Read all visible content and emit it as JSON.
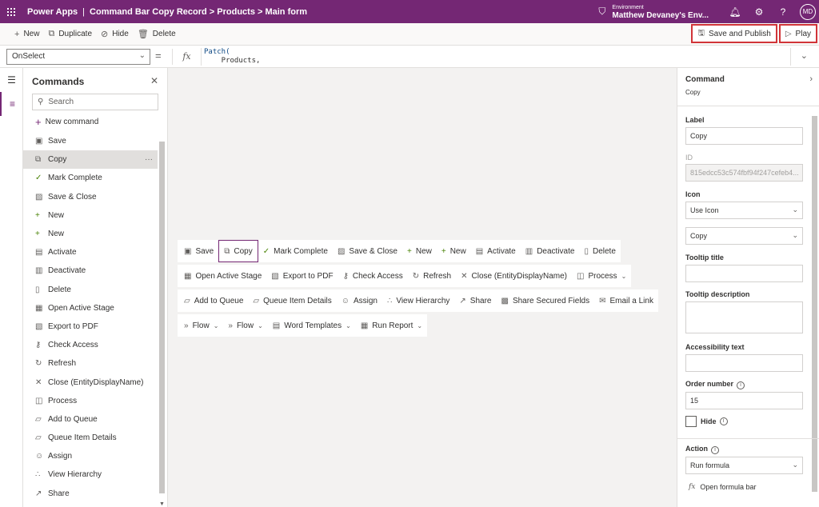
{
  "header": {
    "app_name": "Power Apps",
    "breadcrumb": "Command Bar Copy Record > Products > Main form",
    "environment_label": "Environment",
    "environment_name": "Matthew Devaney's Env...",
    "avatar_initials": "MD"
  },
  "toolbar": {
    "new_label": "New",
    "duplicate_label": "Duplicate",
    "hide_label": "Hide",
    "delete_label": "Delete",
    "save_publish_label": "Save and Publish",
    "play_label": "Play"
  },
  "formula": {
    "property": "OnSelect",
    "line1": "Patch(",
    "line2": "    Products,"
  },
  "commands_panel": {
    "title": "Commands",
    "search_placeholder": "Search",
    "new_command_label": "New command",
    "items": [
      {
        "label": "Save",
        "icon": "save-icon"
      },
      {
        "label": "Copy",
        "icon": "copy-icon"
      },
      {
        "label": "Mark Complete",
        "icon": "checkmark-icon"
      },
      {
        "label": "Save & Close",
        "icon": "save-close-icon"
      },
      {
        "label": "New",
        "icon": "add-icon"
      },
      {
        "label": "New",
        "icon": "add-icon"
      },
      {
        "label": "Activate",
        "icon": "activate-icon"
      },
      {
        "label": "Deactivate",
        "icon": "deactivate-icon"
      },
      {
        "label": "Delete",
        "icon": "delete-icon"
      },
      {
        "label": "Open Active Stage",
        "icon": "stage-icon"
      },
      {
        "label": "Export to PDF",
        "icon": "pdf-icon"
      },
      {
        "label": "Check Access",
        "icon": "key-icon"
      },
      {
        "label": "Refresh",
        "icon": "refresh-icon"
      },
      {
        "label": "Close (EntityDisplayName)",
        "icon": "close-icon"
      },
      {
        "label": "Process",
        "icon": "process-icon"
      },
      {
        "label": "Add to Queue",
        "icon": "queue-icon"
      },
      {
        "label": "Queue Item Details",
        "icon": "queue-details-icon"
      },
      {
        "label": "Assign",
        "icon": "assign-icon"
      },
      {
        "label": "View Hierarchy",
        "icon": "hierarchy-icon"
      },
      {
        "label": "Share",
        "icon": "share-icon"
      }
    ]
  },
  "canvas": {
    "rows": [
      [
        "Save",
        "Copy",
        "Mark Complete",
        "Save & Close",
        "New",
        "New",
        "Activate",
        "Deactivate",
        "Delete"
      ],
      [
        "Open Active Stage",
        "Export to PDF",
        "Check Access",
        "Refresh",
        "Close (EntityDisplayName)",
        "Process"
      ],
      [
        "Add to Queue",
        "Queue Item Details",
        "Assign",
        "View Hierarchy",
        "Share",
        "Share Secured Fields",
        "Email a Link"
      ],
      [
        "Flow",
        "Flow",
        "Word Templates",
        "Run Report"
      ]
    ]
  },
  "properties": {
    "title": "Command",
    "subtitle": "Copy",
    "label_label": "Label",
    "label_value": "Copy",
    "id_label": "ID",
    "id_value": "815edcc53c574fbf94f247cefeb4...",
    "icon_label": "Icon",
    "icon_mode": "Use Icon",
    "icon_value": "Copy",
    "tooltip_title_label": "Tooltip title",
    "tooltip_desc_label": "Tooltip description",
    "accessibility_label": "Accessibility text",
    "order_label": "Order number",
    "order_value": "15",
    "hide_label": "Hide",
    "action_label": "Action",
    "action_value": "Run formula",
    "open_formula_label": "Open formula bar"
  }
}
